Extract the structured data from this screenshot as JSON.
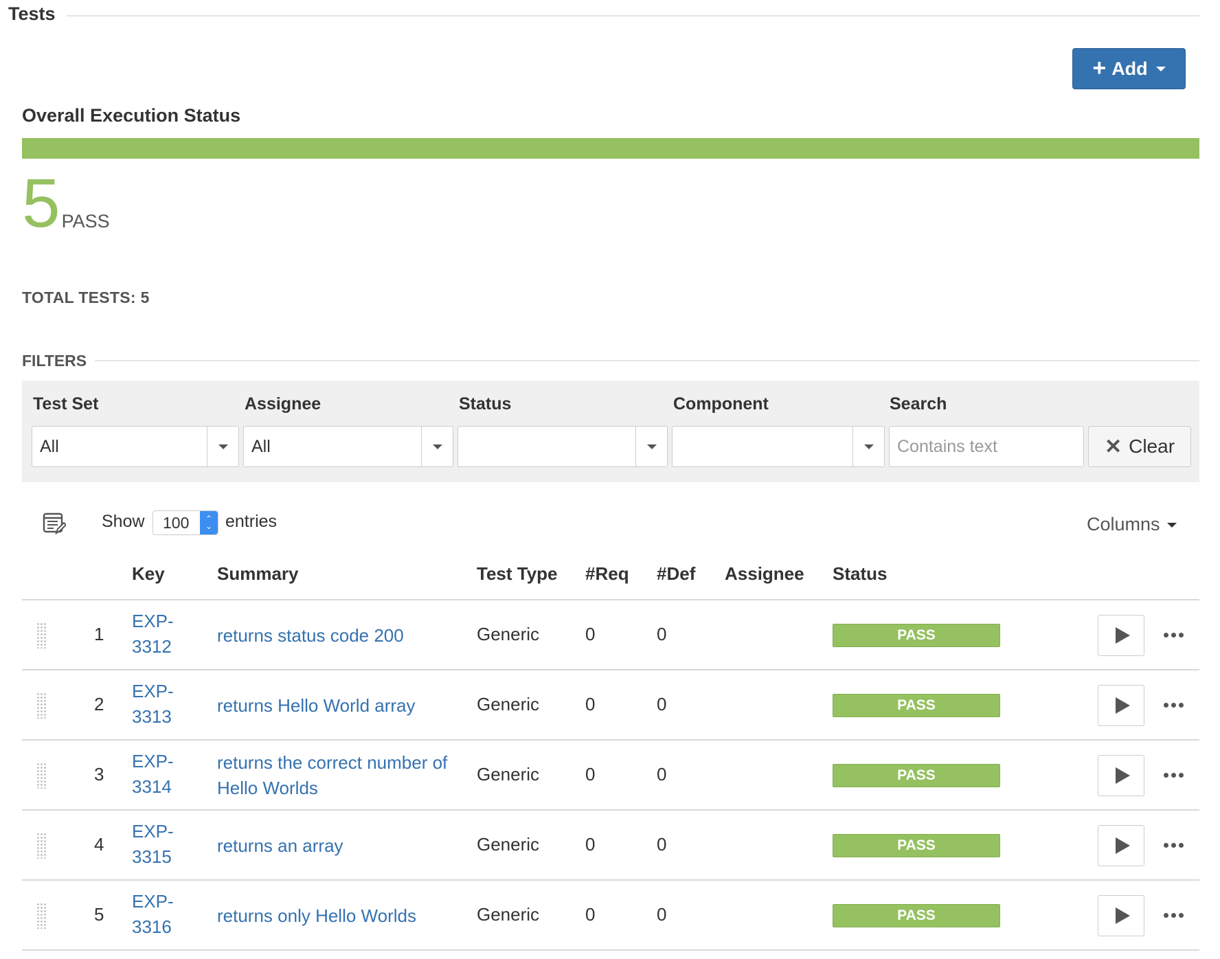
{
  "header": {
    "title": "Tests"
  },
  "add_button": {
    "label": "Add"
  },
  "overall": {
    "title": "Overall Execution Status",
    "progress_pass_fraction": 1.0,
    "pass_count": "5",
    "pass_label": "PASS",
    "total_tests": "TOTAL TESTS: 5"
  },
  "colors": {
    "pass": "#95c160",
    "primary": "#3572b0",
    "link": "#3572b0"
  },
  "filters": {
    "title": "FILTERS",
    "test_set": {
      "label": "Test Set",
      "value": "All"
    },
    "assignee": {
      "label": "Assignee",
      "value": "All"
    },
    "status": {
      "label": "Status",
      "value": ""
    },
    "component": {
      "label": "Component",
      "value": ""
    },
    "search": {
      "label": "Search",
      "value": "",
      "placeholder": "Contains text"
    },
    "clear_label": "Clear"
  },
  "controls": {
    "show_label": "Show",
    "entries_value": "100",
    "entries_label": "entries",
    "columns_label": "Columns"
  },
  "table": {
    "headers": {
      "key": "Key",
      "summary": "Summary",
      "test_type": "Test Type",
      "req": "#Req",
      "def": "#Def",
      "assignee": "Assignee",
      "status": "Status"
    },
    "rows": [
      {
        "num": "1",
        "key_a": "EXP-",
        "key_b": "3312",
        "summary": "returns status code 200",
        "type": "Generic",
        "req": "0",
        "def": "0",
        "assignee": "",
        "status": "PASS"
      },
      {
        "num": "2",
        "key_a": "EXP-",
        "key_b": "3313",
        "summary": "returns Hello World array",
        "type": "Generic",
        "req": "0",
        "def": "0",
        "assignee": "",
        "status": "PASS"
      },
      {
        "num": "3",
        "key_a": "EXP-",
        "key_b": "3314",
        "summary": "returns the correct number of Hello Worlds",
        "type": "Generic",
        "req": "0",
        "def": "0",
        "assignee": "",
        "status": "PASS"
      },
      {
        "num": "4",
        "key_a": "EXP-",
        "key_b": "3315",
        "summary": "returns an array",
        "type": "Generic",
        "req": "0",
        "def": "0",
        "assignee": "",
        "status": "PASS"
      },
      {
        "num": "5",
        "key_a": "EXP-",
        "key_b": "3316",
        "summary": "returns only Hello Worlds",
        "type": "Generic",
        "req": "0",
        "def": "0",
        "assignee": "",
        "status": "PASS"
      }
    ]
  }
}
